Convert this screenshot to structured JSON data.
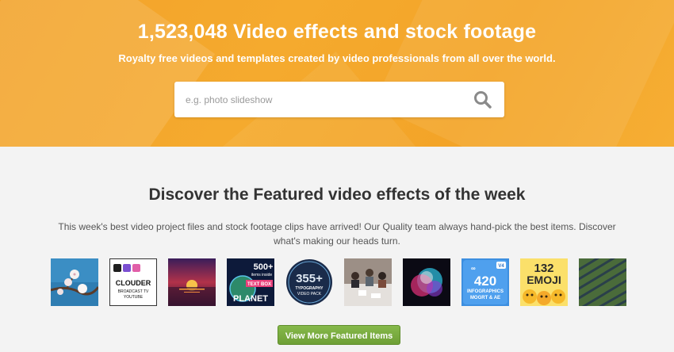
{
  "hero": {
    "title": "1,523,048 Video effects and stock footage",
    "subtitle": "Royalty free videos and templates created by video professionals from all over the world.",
    "search_placeholder": "e.g. photo slideshow",
    "search_icon": "search-icon",
    "background_color": "#f4a62c"
  },
  "featured": {
    "title": "Discover the Featured video effects of the week",
    "description": "This week's best video project files and stock footage clips have arrived! Our Quality team always hand-pick the best items. Discover what's making our heads turn.",
    "thumbnails": [
      {
        "name": "cherry-blossom-thumbnail"
      },
      {
        "name": "clouder-thumbnail",
        "line1": "CLOUDER",
        "line2": "BROADCAST TV",
        "line3": "YOUTUBE"
      },
      {
        "name": "sunset-thumbnail"
      },
      {
        "name": "text-box-planet-thumbnail",
        "line1": "500+",
        "line2": "items inside",
        "line3": "TEXT BOX",
        "line4": "PLANET"
      },
      {
        "name": "typography-pack-thumbnail",
        "line1": "355+",
        "line2": "TYPOGRAPHY",
        "line3": "VIDEO PACK"
      },
      {
        "name": "meeting-thumbnail"
      },
      {
        "name": "color-powder-thumbnail"
      },
      {
        "name": "infographics-thumbnail",
        "line1": "420",
        "line2": "V4",
        "line3": "INFOGRAPHICS",
        "line4": "MOGRT & AE"
      },
      {
        "name": "emoji-thumbnail",
        "line1": "132",
        "line2": "EMOJI"
      },
      {
        "name": "solar-farm-thumbnail"
      }
    ],
    "button_label": "View More Featured Items",
    "button_color": "#78aa3c"
  }
}
